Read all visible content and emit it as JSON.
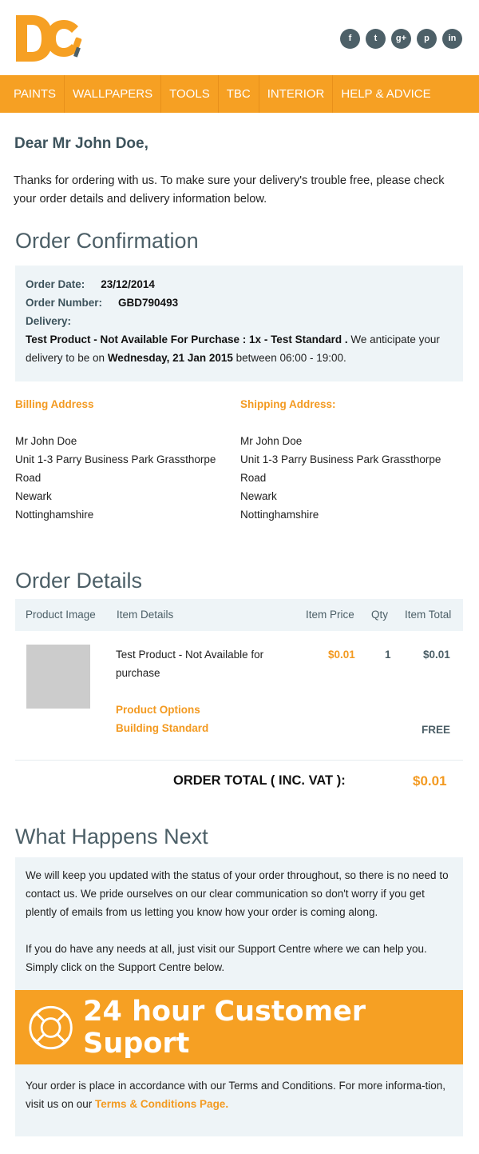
{
  "header": {
    "logo_text": "DC",
    "social": [
      {
        "name": "facebook-icon",
        "glyph": "f"
      },
      {
        "name": "twitter-icon",
        "glyph": "t"
      },
      {
        "name": "google-plus-icon",
        "glyph": "g+"
      },
      {
        "name": "pinterest-icon",
        "glyph": "p"
      },
      {
        "name": "linkedin-icon",
        "glyph": "in"
      }
    ]
  },
  "nav": {
    "items": [
      "PAINTS",
      "WALLPAPERS",
      "TOOLS",
      "TBC",
      "INTERIOR",
      "HELP & ADVICE"
    ]
  },
  "greeting": "Dear Mr John Doe,",
  "intro": "Thanks for ordering with us. To make sure your delivery's trouble free, please check your order details and delivery information below.",
  "confirmation": {
    "title": "Order Confirmation",
    "order_date_label": "Order Date:",
    "order_date": "23/12/2014",
    "order_number_label": "Order Number:",
    "order_number": "GBD790493",
    "delivery_label": "Delivery:",
    "delivery_product": "Test Product - Not Available For Purchase : 1x - Test Standard .",
    "delivery_anticipate": " We anticipate your delivery to be on ",
    "delivery_date": "Wednesday, 21 Jan 2015",
    "delivery_window": " between 06:00 - 19:00."
  },
  "billing": {
    "title": "Billing Address",
    "lines": [
      "Mr John Doe",
      "Unit 1-3 Parry Business Park Grassthorpe Road",
      "Newark",
      "Nottinghamshire"
    ]
  },
  "shipping": {
    "title": "Shipping Address:",
    "lines": [
      "Mr John Doe",
      "Unit 1-3 Parry Business Park Grassthorpe Road",
      "Newark",
      "Nottinghamshire"
    ]
  },
  "order_details": {
    "title": "Order Details",
    "columns": {
      "image": "Product Image",
      "details": "Item Details",
      "price": "Item Price",
      "qty": "Qty",
      "total": "Item Total"
    },
    "item": {
      "name": "Test Product - Not Available for purchase",
      "price": "$0.01",
      "qty": "1",
      "total": "$0.01",
      "options_label": "Product Options",
      "option_value": "Building Standard",
      "option_price": "FREE"
    },
    "order_total_label": "ORDER TOTAL ( INC. VAT ):",
    "order_total_value": "$0.01"
  },
  "next": {
    "title": "What Happens Next",
    "para1": "We will keep you updated with the status of your order throughout, so there is no need to contact us. We pride ourselves on our clear communication so don't worry if you get plently of emails from us letting you know how your order is coming along.",
    "para2": "If you do have any needs at all, just visit our Support Centre where we can help you. Simply click on the Support Centre below."
  },
  "support_banner": {
    "text": "24 hour Customer Suport",
    "icon": "lifebuoy-icon"
  },
  "terms": {
    "text": "Your order is place in accordance with our Terms and Conditions. For more informa-tion, visit us on our ",
    "link": "Terms & Conditions Page."
  },
  "colors": {
    "brand_orange": "#f6a023",
    "text_slate": "#4c5f67",
    "panel_bg": "#eef4f7"
  }
}
